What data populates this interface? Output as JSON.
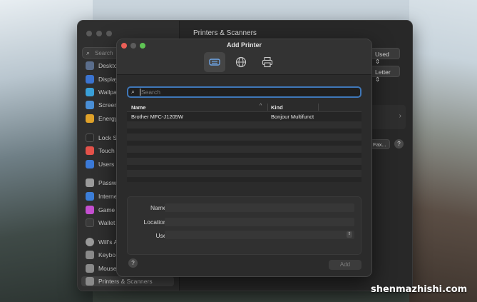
{
  "sysprefs": {
    "title": "Printers & Scanners",
    "search_placeholder": "Search",
    "sidebar_items": [
      {
        "label": "Deskto",
        "color": "#5b6e8c"
      },
      {
        "label": "Display",
        "color": "#3b74d1"
      },
      {
        "label": "Wallpa",
        "color": "#3aa0d8"
      },
      {
        "label": "Screen",
        "color": "#4a8fd6"
      },
      {
        "label": "Energy",
        "color": "#e0a22a"
      },
      {
        "label": "Lock S",
        "color": "#2a2a2a"
      },
      {
        "label": "Touch",
        "color": "#e4524a"
      },
      {
        "label": "Users",
        "color": "#3b7ad8"
      },
      {
        "label": "Passw",
        "color": "#9b9b9b"
      },
      {
        "label": "Interne",
        "color": "#3c7ed8"
      },
      {
        "label": "Game",
        "color": "#c44fd0"
      },
      {
        "label": "Wallet",
        "color": "#3a3a3a"
      },
      {
        "label": "Will's A",
        "color": "#9a9a9a"
      },
      {
        "label": "Keybo",
        "color": "#8a8a8a"
      },
      {
        "label": "Mouse",
        "color": "#8a8a8a"
      },
      {
        "label": "Printers & Scanners",
        "color": "#8a8a8a"
      }
    ],
    "used_label": "Used",
    "letter_label": "Letter",
    "fax_label": "Fax...",
    "help": "?"
  },
  "dialog": {
    "title": "Add Printer",
    "tabs": [
      {
        "name": "default-printers-tab"
      },
      {
        "name": "ip-printer-tab"
      },
      {
        "name": "windows-printer-tab"
      }
    ],
    "search_placeholder": "Search",
    "columns": {
      "name": "Name",
      "kind": "Kind",
      "sort": "^"
    },
    "rows": [
      {
        "name": "Brother MFC-J1205W",
        "kind": "Bonjour Multifunct"
      }
    ],
    "form": {
      "name_label": "Name:",
      "location_label": "Location:",
      "use_label": "Use:"
    },
    "help": "?",
    "add_label": "Add"
  },
  "watermark": "shenmazhishi.com"
}
